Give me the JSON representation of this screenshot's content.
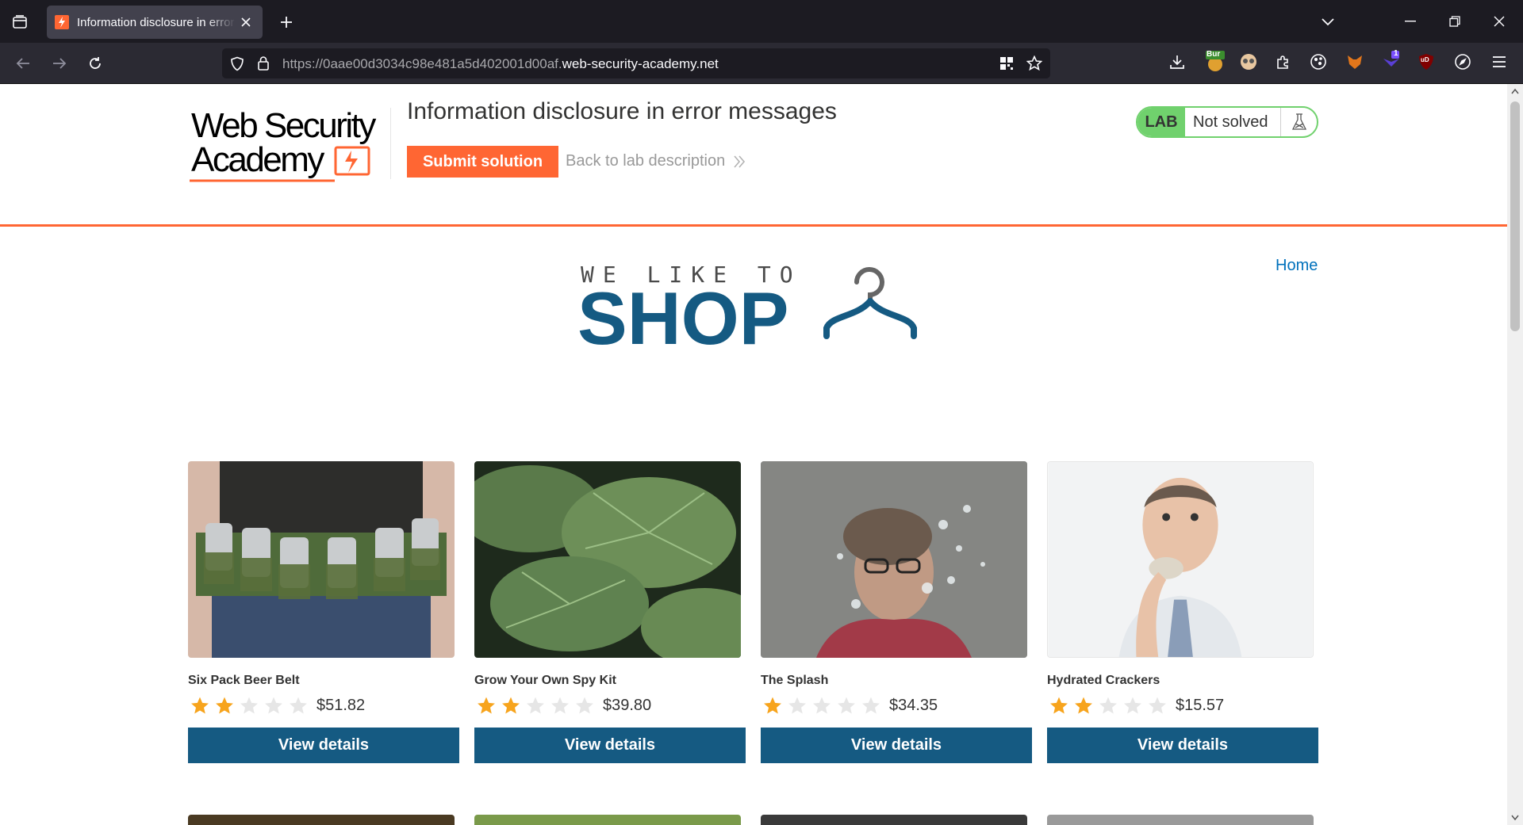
{
  "browser": {
    "tab_title": "Information disclosure in error messages",
    "url_prefix": "https://0aae00d3034c98e481a5d402001d00af.",
    "url_domain": "web-security-academy.net",
    "extension_badges": {
      "burp": "Bur",
      "notify": "1",
      "ublock": "uD"
    }
  },
  "lab": {
    "logo_line1": "Web Security",
    "logo_line2": "Academy",
    "title": "Information disclosure in error messages",
    "submit_label": "Submit solution",
    "back_label": "Back to lab description",
    "status_tag": "LAB",
    "status_text": "Not solved"
  },
  "nav": {
    "home": "Home"
  },
  "banner": {
    "line1": "WE LIKE TO",
    "line2": "SHOP"
  },
  "colors": {
    "accent": "#ff6633",
    "primary": "#155a82",
    "lab_green": "#70d16d",
    "link": "#0071bc",
    "star": "#f7a41d"
  },
  "products": [
    {
      "name": "Six Pack Beer Belt",
      "rating": 2,
      "price": "$51.82",
      "button": "View details"
    },
    {
      "name": "Grow Your Own Spy Kit",
      "rating": 2,
      "price": "$39.80",
      "button": "View details"
    },
    {
      "name": "The Splash",
      "rating": 1,
      "price": "$34.35",
      "button": "View details"
    },
    {
      "name": "Hydrated Crackers",
      "rating": 2,
      "price": "$15.57",
      "button": "View details"
    }
  ]
}
